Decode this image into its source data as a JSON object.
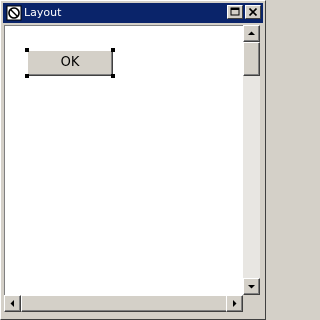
{
  "window": {
    "title": "Layout",
    "icon": "app-window-icon",
    "controls": [
      "maximize-icon",
      "close-icon"
    ]
  },
  "canvas": {
    "button_label": "OK",
    "button_selected": true
  },
  "scrollbars": {
    "vertical": [
      "scroll-up-icon",
      "scroll-down-icon"
    ],
    "horizontal": [
      "scroll-left-icon",
      "scroll-right-icon"
    ]
  }
}
